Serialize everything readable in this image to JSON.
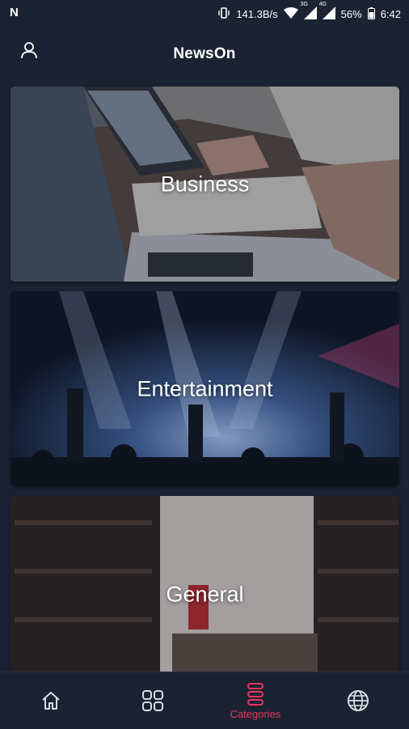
{
  "status_bar": {
    "carrier_icon": "n-logo-icon",
    "network_speed": "141.3B/s",
    "network_type": "3G",
    "network_type_2": "4G",
    "battery": "56%",
    "time": "6:42"
  },
  "header": {
    "title": "NewsOn",
    "profile_icon": "user-icon"
  },
  "categories": [
    {
      "label": "Business"
    },
    {
      "label": "Entertainment"
    },
    {
      "label": "General"
    }
  ],
  "bottom_nav": {
    "items": [
      {
        "icon": "home-icon",
        "label": ""
      },
      {
        "icon": "grid-icon",
        "label": ""
      },
      {
        "icon": "categories-icon",
        "label": "Categories",
        "active": true
      },
      {
        "icon": "globe-icon",
        "label": ""
      }
    ]
  },
  "colors": {
    "background": "#1b2333",
    "accent": "#e8365b"
  }
}
